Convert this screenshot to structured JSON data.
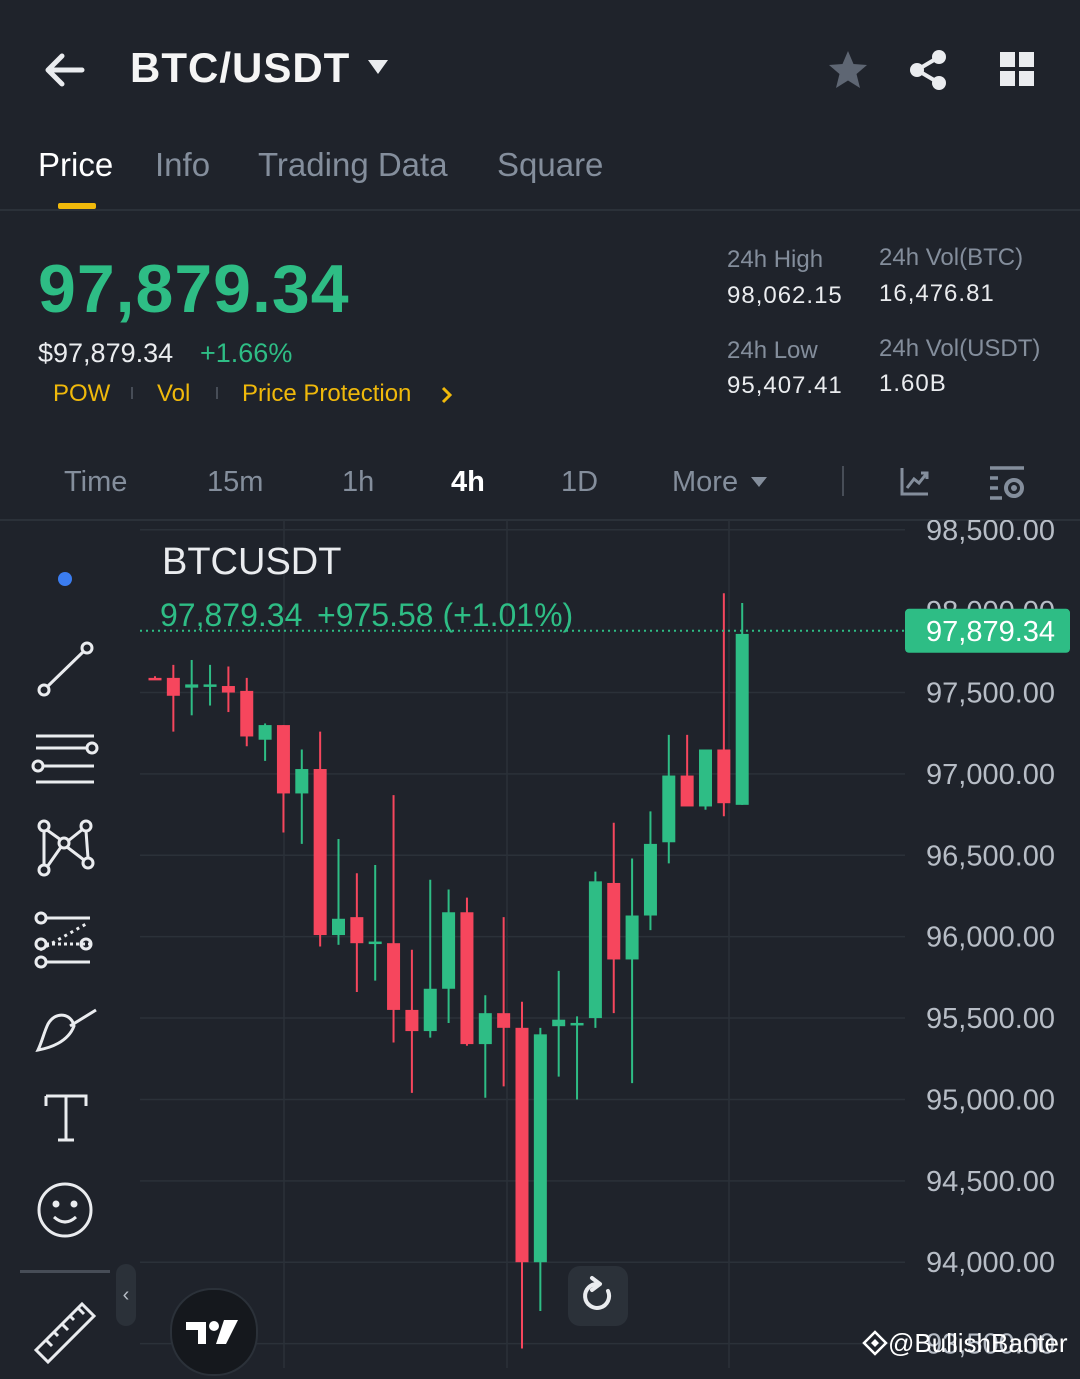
{
  "header": {
    "pair": "BTC/USDT",
    "back_icon": "arrow-left-icon",
    "favorite_icon": "star-icon",
    "share_icon": "share-icon",
    "grid_icon": "grid-icon"
  },
  "tabs": [
    {
      "label": "Price",
      "active": true
    },
    {
      "label": "Info"
    },
    {
      "label": "Trading Data"
    },
    {
      "label": "Square"
    }
  ],
  "price": {
    "last": "97,879.34",
    "usd": "$97,879.34",
    "change_pct": "+1.66%",
    "tags": [
      "POW",
      "Vol",
      "Price Protection"
    ]
  },
  "stats": {
    "high_label": "24h High",
    "high_value": "98,062.15",
    "low_label": "24h Low",
    "low_value": "95,407.41",
    "vol_btc_label": "24h Vol(BTC)",
    "vol_btc_value": "16,476.81",
    "vol_usdt_label": "24h Vol(USDT)",
    "vol_usdt_value": "1.60B"
  },
  "intervals": [
    {
      "label": "Time"
    },
    {
      "label": "15m"
    },
    {
      "label": "1h"
    },
    {
      "label": "4h",
      "active": true
    },
    {
      "label": "1D"
    },
    {
      "label": "More"
    }
  ],
  "chart": {
    "symbol": "BTCUSDT",
    "legend_price": "97,879.34",
    "legend_change": "+975.58 (+1.01%)",
    "last_price_label": "97,879.34",
    "partial_label": "98,000.00",
    "colors": {
      "up": "#2ebd85",
      "down": "#f6465d",
      "grid": "#2b3139",
      "accent": "#f0b90b"
    }
  },
  "chart_data": {
    "type": "candlestick",
    "y_ticks": [
      "98,500.00",
      "97,500.00",
      "97,000.00",
      "96,500.00",
      "96,000.00",
      "95,500.00",
      "95,000.00",
      "94,500.00",
      "94,000.00",
      "93,500.00"
    ],
    "ylim": [
      93350,
      98560
    ],
    "last_price": 97879.34,
    "candles": [
      {
        "o": 97590,
        "h": 97600,
        "l": 97580,
        "c": 97585
      },
      {
        "o": 97590,
        "h": 97670,
        "l": 97260,
        "c": 97480
      },
      {
        "o": 97530,
        "h": 97700,
        "l": 97360,
        "c": 97550
      },
      {
        "o": 97540,
        "h": 97670,
        "l": 97420,
        "c": 97550
      },
      {
        "o": 97540,
        "h": 97660,
        "l": 97380,
        "c": 97500
      },
      {
        "o": 97510,
        "h": 97590,
        "l": 97170,
        "c": 97230
      },
      {
        "o": 97210,
        "h": 97310,
        "l": 97080,
        "c": 97300
      },
      {
        "o": 97300,
        "h": 97300,
        "l": 96640,
        "c": 96880
      },
      {
        "o": 96880,
        "h": 97150,
        "l": 96570,
        "c": 97030
      },
      {
        "o": 97030,
        "h": 97260,
        "l": 95940,
        "c": 96010
      },
      {
        "o": 96010,
        "h": 96600,
        "l": 95950,
        "c": 96110
      },
      {
        "o": 96120,
        "h": 96390,
        "l": 95660,
        "c": 95960
      },
      {
        "o": 95970,
        "h": 96440,
        "l": 95730,
        "c": 95970
      },
      {
        "o": 95960,
        "h": 96870,
        "l": 95350,
        "c": 95550
      },
      {
        "o": 95550,
        "h": 95920,
        "l": 95040,
        "c": 95420
      },
      {
        "o": 95420,
        "h": 96350,
        "l": 95380,
        "c": 95680
      },
      {
        "o": 95680,
        "h": 96290,
        "l": 95470,
        "c": 96150
      },
      {
        "o": 96150,
        "h": 96240,
        "l": 95330,
        "c": 95340
      },
      {
        "o": 95340,
        "h": 95640,
        "l": 95010,
        "c": 95530
      },
      {
        "o": 95530,
        "h": 96120,
        "l": 95080,
        "c": 95440
      },
      {
        "o": 95440,
        "h": 95600,
        "l": 93470,
        "c": 94000
      },
      {
        "o": 94000,
        "h": 95440,
        "l": 93700,
        "c": 95400
      },
      {
        "o": 95450,
        "h": 95790,
        "l": 95140,
        "c": 95490
      },
      {
        "o": 95470,
        "h": 95510,
        "l": 95000,
        "c": 95470
      },
      {
        "o": 95500,
        "h": 96400,
        "l": 95440,
        "c": 96340
      },
      {
        "o": 96330,
        "h": 96700,
        "l": 95530,
        "c": 95860
      },
      {
        "o": 95860,
        "h": 96480,
        "l": 95100,
        "c": 96130
      },
      {
        "o": 96130,
        "h": 96770,
        "l": 96040,
        "c": 96570
      },
      {
        "o": 96580,
        "h": 97240,
        "l": 96450,
        "c": 96990
      },
      {
        "o": 96990,
        "h": 97240,
        "l": 96850,
        "c": 96800
      },
      {
        "o": 96800,
        "h": 97140,
        "l": 96780,
        "c": 97150
      },
      {
        "o": 97150,
        "h": 98110,
        "l": 96740,
        "c": 96820
      },
      {
        "o": 96810,
        "h": 98050,
        "l": 96810,
        "c": 97860
      }
    ]
  },
  "watermark": "@BullishBanter"
}
